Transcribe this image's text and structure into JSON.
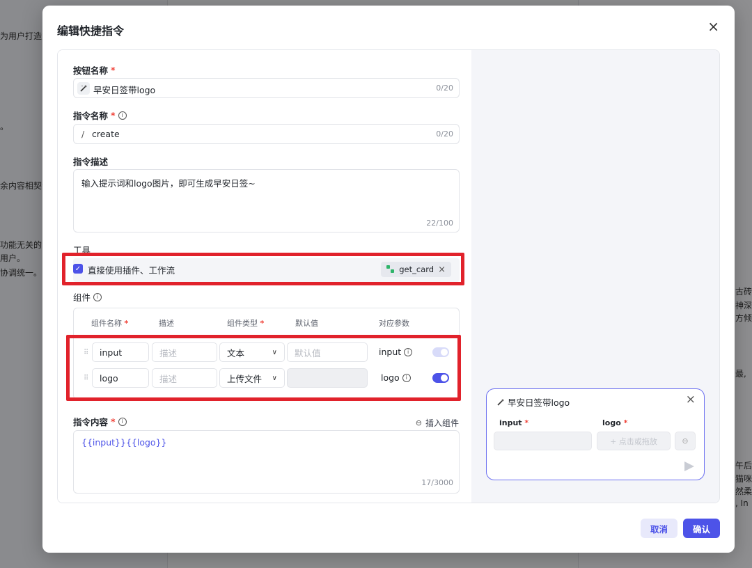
{
  "background": {
    "left_snippets": [
      "为用户打造究",
      "。",
      "余内容相契合",
      "功能无关的",
      "用户。",
      "协调统一。"
    ],
    "right_snippets": [
      "古砖",
      "神深",
      "方倾",
      "最,",
      "午后",
      "猫咪",
      "然柔",
      ", In"
    ]
  },
  "modal": {
    "title": "编辑快捷指令",
    "close_label": "×"
  },
  "form": {
    "button_name": {
      "label": "按钮名称",
      "required_mark": "*",
      "value": "早安日签带logo",
      "counter": "0/20"
    },
    "command_name": {
      "label": "指令名称",
      "required_mark": "*",
      "prefix": "/",
      "value": "create",
      "counter": "0/20"
    },
    "description": {
      "label": "指令描述",
      "value": "输入提示词和logo图片，即可生成早安日签~",
      "counter": "22/100"
    },
    "tools": {
      "label": "工具",
      "checkbox_label": "直接使用插件、工作流",
      "checked": true,
      "tag_label": "get_card",
      "tag_remove": "×"
    },
    "components": {
      "label": "组件",
      "headers": [
        {
          "label": "组件名称",
          "required": "*"
        },
        {
          "label": "描述",
          "required": ""
        },
        {
          "label": "组件类型",
          "required": "*"
        },
        {
          "label": "默认值",
          "required": ""
        },
        {
          "label": "对应参数",
          "required": ""
        }
      ],
      "rows": [
        {
          "name": "input",
          "desc_placeholder": "描述",
          "type": "文本",
          "default_placeholder": "默认值",
          "param": "input",
          "toggle_on": false
        },
        {
          "name": "logo",
          "desc_placeholder": "描述",
          "type": "上传文件",
          "default_placeholder": "",
          "param": "logo",
          "toggle_on": true
        }
      ]
    },
    "content": {
      "label": "指令内容",
      "required_mark": "*",
      "insert_label": "插入组件",
      "value": "{{input}}{{logo}}",
      "counter": "17/3000"
    }
  },
  "preview": {
    "title": "早安日签带logo",
    "close_label": "×",
    "fields": [
      {
        "label": "input",
        "required": "*"
      },
      {
        "label": "logo",
        "required": "*",
        "placeholder": "+ 点击或拖放"
      }
    ]
  },
  "footer": {
    "cancel_label": "取消",
    "confirm_label": "确认"
  },
  "colors": {
    "accent": "#4d53e8",
    "highlight": "#e1222b",
    "required": "#f0443a"
  }
}
